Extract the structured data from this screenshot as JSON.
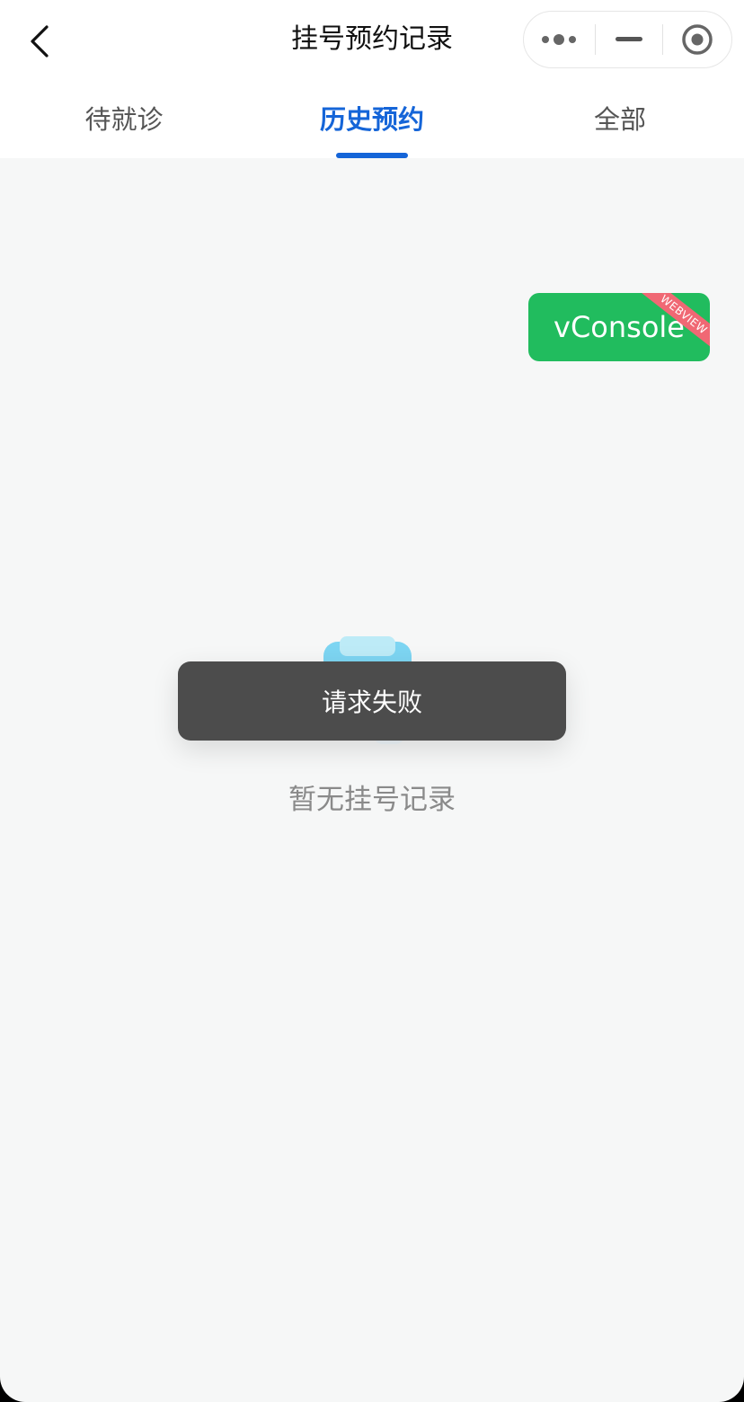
{
  "navbar": {
    "title": "挂号预约记录",
    "back_icon": "chevron-left-icon",
    "capsule": {
      "more_icon": "more-dots-icon",
      "minimize_icon": "minimize-icon",
      "close_icon": "target-close-icon"
    }
  },
  "tabs": [
    {
      "label": "待就诊",
      "active": false
    },
    {
      "label": "历史预约",
      "active": true
    },
    {
      "label": "全部",
      "active": false
    }
  ],
  "vconsole": {
    "label": "vConsole",
    "ribbon": "WEBVIEW",
    "color": "#21bc5e",
    "ribbon_color": "#f06874"
  },
  "empty_state": {
    "icon": "empty-box-icon",
    "message": "暂无挂号记录"
  },
  "toast": {
    "message": "请求失败"
  },
  "colors": {
    "accent": "#1565d8",
    "background": "#f6f7f7",
    "toast_bg": "#4c4c4c"
  }
}
